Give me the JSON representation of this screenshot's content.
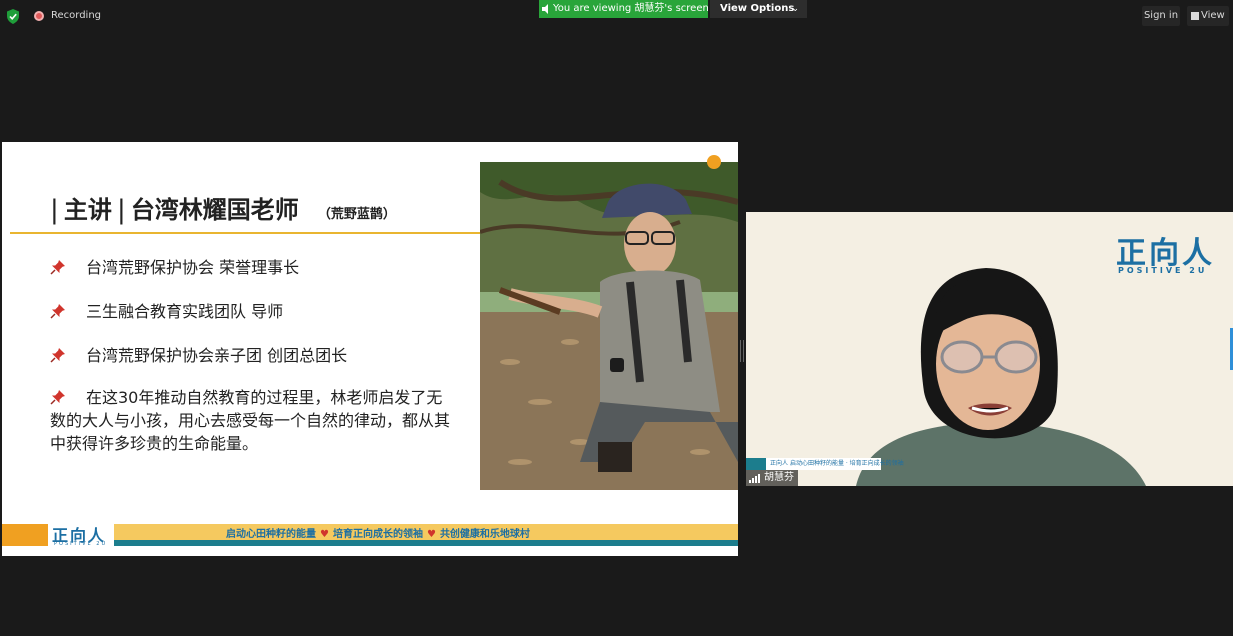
{
  "topbar": {
    "recording_label": "Recording",
    "viewing_text": "You are viewing 胡慧芬's screen",
    "view_options_label": "View Options",
    "sign_in_label": "Sign in",
    "view_label": "View"
  },
  "slide": {
    "title_bar_left": "|",
    "title_speaker_tag": "主讲",
    "title_bar_mid": "|",
    "title_name": "台湾林耀国老师",
    "title_alias": "（荒野蓝鹊）",
    "bullets": [
      "台湾荒野保护协会 荣誉理事长",
      "三生融合教育实践团队 导师",
      "台湾荒野保护协会亲子团 创团总团长"
    ],
    "paragraph": "在这30年推动自然教育的过程里，林老师启发了无数的大人与小孩，用心去感受每一个自然的律动，都从其中获得许多珍贵的生命能量。",
    "footer": {
      "logo_text": "正向人",
      "logo_sub": "POSITIVE 2U",
      "slogan_1": "启动心田种籽的能量",
      "slogan_2": "培育正向成长的领袖",
      "slogan_3": "共创健康和乐地球村"
    }
  },
  "video": {
    "logo_text": "正向人",
    "logo_sub": "POSITIVE 2U",
    "strip_logo": "正向人",
    "strip_text": "启动心田种籽的能量 · 培育正向成长的领袖",
    "participant_name": "胡慧芬"
  },
  "colors": {
    "viewing_banner": "#29a53a",
    "brand_blue": "#1c6fa3",
    "brand_teal": "#1c7d8d",
    "accent_yellow": "#f5c95f"
  }
}
